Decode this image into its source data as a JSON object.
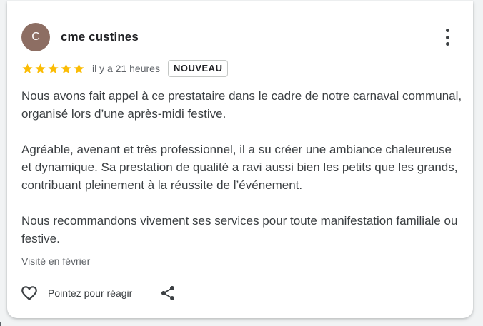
{
  "review": {
    "avatar_letter": "C",
    "author_name": "cme custines",
    "rating": 5,
    "rating_max": 5,
    "time_ago": "il y a 21 heures",
    "badge": "NOUVEAU",
    "paragraphs": [
      "Nous avons fait appel à ce prestataire dans le cadre de notre carnaval communal, organisé lors d’une après-midi festive.",
      "Agréable, avenant et très professionnel, il a su créer une ambiance chaleureuse et dynamique. Sa prestation de qualité a ravi aussi bien les petits que les grands, contribuant pleinement à la réussite de l’événement.",
      "Nous recommandons vivement ses services pour toute manifestation familiale ou festive."
    ],
    "visited": "Visité en février",
    "react_label": "Pointez pour réagir",
    "icons": {
      "more": "more-vert-icon",
      "star": "star-icon",
      "heart": "heart-outline-icon",
      "share": "share-icon"
    }
  },
  "colors": {
    "avatar_bg": "#8d6e63",
    "star": "#fbbc04",
    "text": "#3c4043",
    "secondary": "#5f6368"
  }
}
